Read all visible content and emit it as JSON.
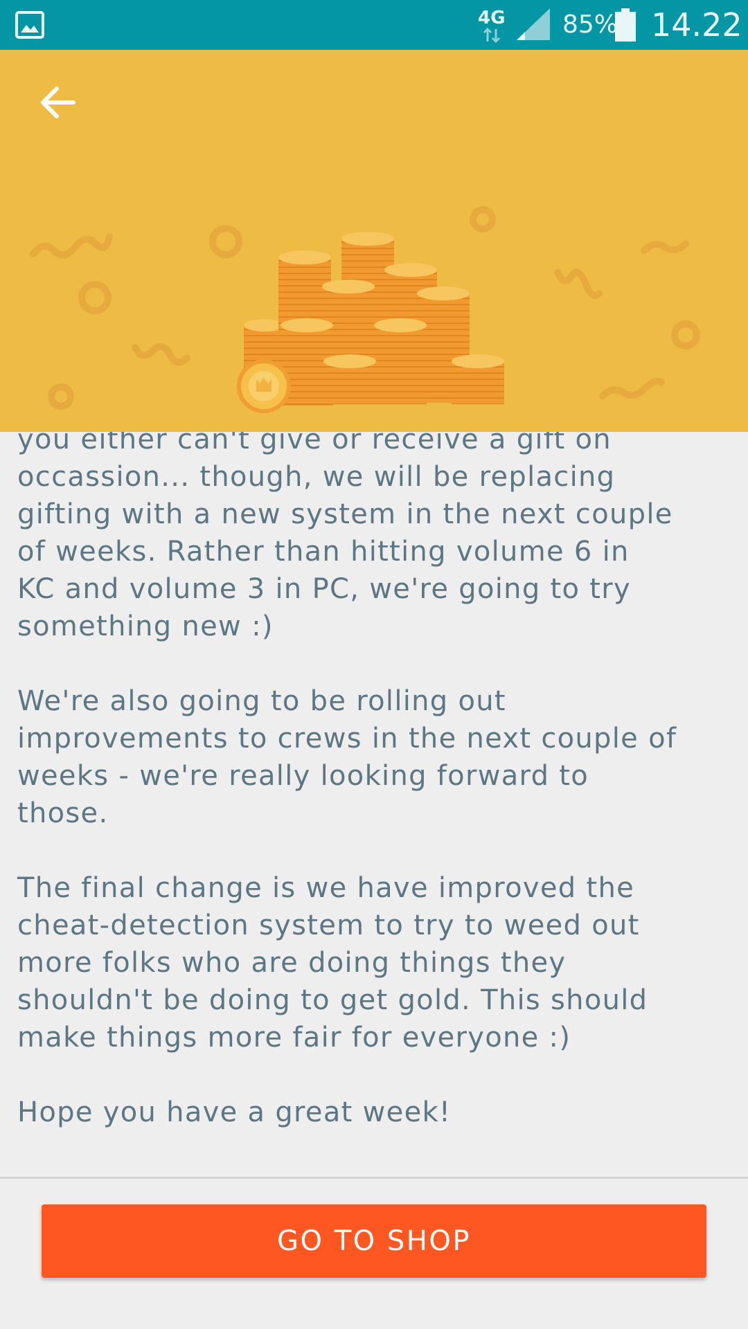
{
  "status_bar": {
    "network": "4G",
    "battery_percent": "85%",
    "time": "14.22",
    "icons": [
      "gallery-icon",
      "network-icon",
      "signal-icon",
      "battery-icon"
    ]
  },
  "header": {
    "back_icon": "arrow-left-icon",
    "background_color": "#eebb45",
    "illustration": "gold-coin-stacks"
  },
  "article": {
    "body": "you either can't give or receive a gift on\noccassion... though, we will be replacing\ngifting with a new system in the next couple\nof weeks. Rather than hitting volume 6 in\nKC and volume 3 in PC, we're going to try\nsomething new :)\n\nWe're also going to be rolling out\nimprovements to crews in the next couple of\nweeks - we're really looking forward to\nthose.\n\nThe final change is we have improved the\ncheat-detection system to try to weed out\nmore folks who are doing things they\nshouldn't be doing to get gold. This should\nmake things more fair for everyone :)\n\nHope you have a great week!"
  },
  "footer": {
    "button_label": "GO TO SHOP",
    "button_color": "#ff5722"
  }
}
